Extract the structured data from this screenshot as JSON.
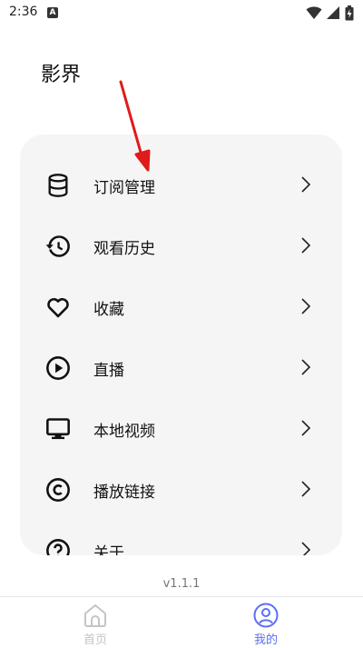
{
  "status": {
    "time": "2:36",
    "notification_letter": "A"
  },
  "app_title": "影界",
  "menu": {
    "items": [
      {
        "label": "订阅管理",
        "icon": "database-icon"
      },
      {
        "label": "观看历史",
        "icon": "history-icon"
      },
      {
        "label": "收藏",
        "icon": "heart-icon"
      },
      {
        "label": "直播",
        "icon": "play-circle-icon"
      },
      {
        "label": "本地视频",
        "icon": "monitor-icon"
      },
      {
        "label": "播放链接",
        "icon": "copyright-icon"
      },
      {
        "label": "关于",
        "icon": "help-circle-icon"
      }
    ]
  },
  "version": "v1.1.1",
  "bottom_nav": {
    "home_label": "首页",
    "mine_label": "我的",
    "active": "mine"
  },
  "colors": {
    "accent": "#5b6ef5",
    "inactive": "#c4c4c4",
    "card_bg": "#f5f5f5",
    "annotation_arrow": "#e01b1b"
  }
}
